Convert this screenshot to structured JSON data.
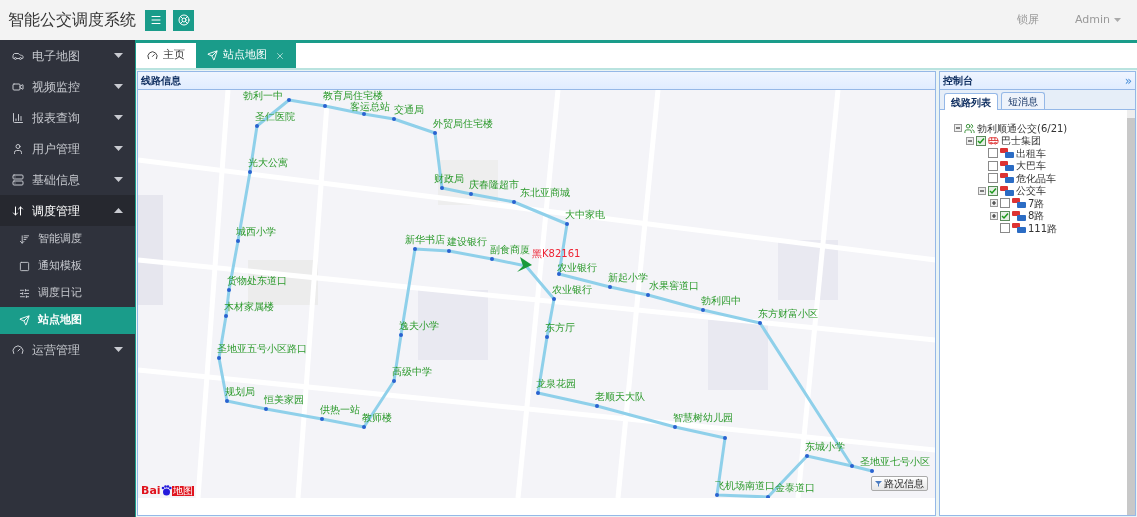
{
  "header": {
    "title": "智能公交调度系统",
    "lock": "锁屏",
    "user": "Admin"
  },
  "sidebar": {
    "items": [
      {
        "label": "电子地图",
        "expanded": false
      },
      {
        "label": "视频监控",
        "expanded": false
      },
      {
        "label": "报表查询",
        "expanded": false
      },
      {
        "label": "用户管理",
        "expanded": false
      },
      {
        "label": "基础信息",
        "expanded": false
      },
      {
        "label": "调度管理",
        "expanded": true,
        "children": [
          {
            "label": "智能调度",
            "selected": false
          },
          {
            "label": "通知模板",
            "selected": false
          },
          {
            "label": "调度日记",
            "selected": false
          },
          {
            "label": "站点地图",
            "selected": true
          }
        ]
      },
      {
        "label": "运营管理",
        "expanded": false
      }
    ]
  },
  "tabs": [
    {
      "label": "主页",
      "selected": false,
      "closable": false
    },
    {
      "label": "站点地图",
      "selected": true,
      "closable": true
    }
  ],
  "map_panel": {
    "title": "线路信息",
    "stations": [
      {
        "name": "勃利一中"
      },
      {
        "name": "教育局住宅楼"
      },
      {
        "name": "客运总站"
      },
      {
        "name": "交通局"
      },
      {
        "name": "圣仁医院"
      },
      {
        "name": "外贸局住宅楼"
      },
      {
        "name": "光大公寓"
      },
      {
        "name": "财政局"
      },
      {
        "name": "庆春隆超市"
      },
      {
        "name": "东北亚商城"
      },
      {
        "name": "大中家电"
      },
      {
        "name": "城西小学"
      },
      {
        "name": "新华书店"
      },
      {
        "name": "建设银行"
      },
      {
        "name": "副食商厦"
      },
      {
        "name": "农业银行"
      },
      {
        "name": "新起小学"
      },
      {
        "name": "货物处东道口"
      },
      {
        "name": "水果窖道口"
      },
      {
        "name": "农业银行"
      },
      {
        "name": "勃利四中"
      },
      {
        "name": "木材家属楼"
      },
      {
        "name": "东方财富小区"
      },
      {
        "name": "逸夫小学"
      },
      {
        "name": "东方厅"
      },
      {
        "name": "圣地亚五号小区路口"
      },
      {
        "name": "高级中学"
      },
      {
        "name": "龙泉花园"
      },
      {
        "name": "规划局"
      },
      {
        "name": "老顺天大队"
      },
      {
        "name": "恒美家园"
      },
      {
        "name": "供热一站"
      },
      {
        "name": "教师楼"
      },
      {
        "name": "智慧树幼儿园"
      },
      {
        "name": "东城小学"
      },
      {
        "name": "圣地亚七号小区"
      },
      {
        "name": "飞机场南道口"
      },
      {
        "name": "金泰道口"
      }
    ],
    "bus": {
      "plate": "黑K82161"
    },
    "traffic_button": "路况信息",
    "logo": {
      "left": "Bai",
      "right": "地图"
    }
  },
  "control_panel": {
    "title": "控制台",
    "collapse": "»",
    "tabs": [
      {
        "label": "线路列表",
        "selected": true
      },
      {
        "label": "短消息",
        "selected": false
      }
    ],
    "tree": [
      {
        "label": "勃利顺通公交(6/21)",
        "expanded": true,
        "children": [
          {
            "label": "巴士集团",
            "checked": true,
            "expanded": true,
            "children": [
              {
                "label": "出租车",
                "checked": false
              },
              {
                "label": "大巴车",
                "checked": false
              },
              {
                "label": "危化品车",
                "checked": false
              },
              {
                "label": "公交车",
                "checked": true,
                "expanded": true,
                "children": [
                  {
                    "label": "7路",
                    "checked": false,
                    "expanded": false
                  },
                  {
                    "label": "8路",
                    "checked": true,
                    "expanded": false
                  },
                  {
                    "label": "111路",
                    "checked": false
                  }
                ]
              }
            ]
          }
        ]
      }
    ]
  }
}
